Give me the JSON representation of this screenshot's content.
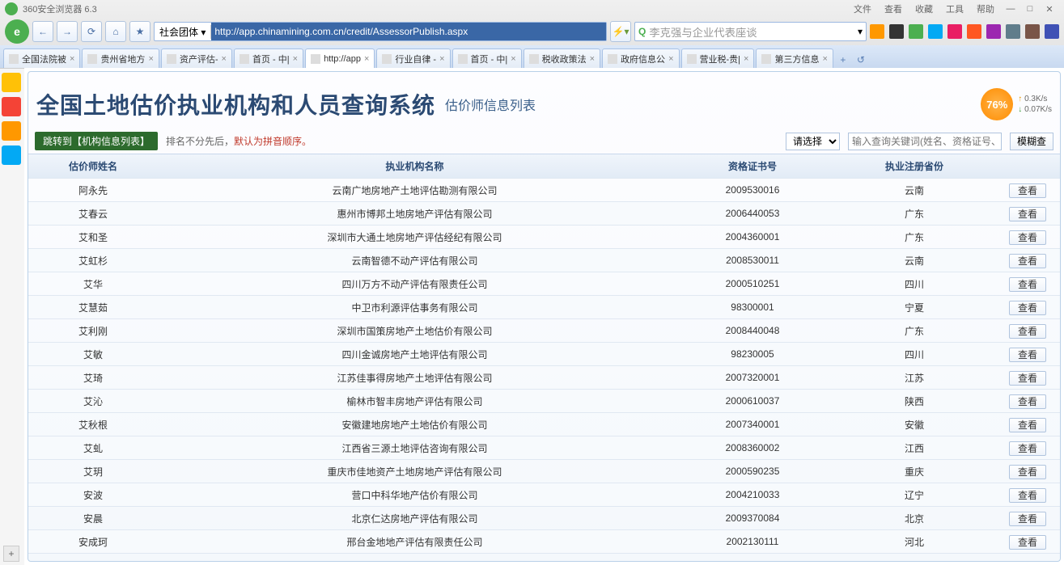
{
  "browser": {
    "title": "360安全浏览器 6.3",
    "menus": [
      "文件",
      "查看",
      "收藏",
      "工具",
      "帮助"
    ],
    "url_category": "社会团体",
    "url": "http://app.chinamining.com.cn/credit/AssessorPublish.aspx",
    "search_placeholder": "李克强与企业代表座谈",
    "net": {
      "pct": "76%",
      "up": "0.3K/s",
      "down": "0.07K/s"
    }
  },
  "tabs": [
    {
      "label": "全国法院被",
      "active": false
    },
    {
      "label": "贵州省地方",
      "active": false
    },
    {
      "label": "资产评估-",
      "active": false
    },
    {
      "label": "首页 - 中|",
      "active": false
    },
    {
      "label": "http://app",
      "active": true
    },
    {
      "label": "行业自律 -",
      "active": false
    },
    {
      "label": "首页 - 中|",
      "active": false
    },
    {
      "label": "税收政策法",
      "active": false
    },
    {
      "label": "政府信息公",
      "active": false
    },
    {
      "label": "营业税-贵|",
      "active": false
    },
    {
      "label": "第三方信息",
      "active": false
    }
  ],
  "page": {
    "title": "全国土地估价执业机构和人员查询系统",
    "subtitle": "估价师信息列表",
    "jump_btn": "跳转到【机构信息列表】",
    "hint_prefix": "排名不分先后，",
    "hint_em": "默认为拼音顺序。",
    "select_default": "请选择",
    "search_placeholder": "输入查询关键词(姓名、资格证号、",
    "search_btn": "模糊查",
    "columns": {
      "name": "估价师姓名",
      "org": "执业机构名称",
      "cert": "资格证书号",
      "prov": "执业注册省份"
    },
    "view_label": "查看",
    "rows": [
      {
        "name": "阿永先",
        "org": "云南广地房地产土地评估勘测有限公司",
        "cert": "2009530016",
        "prov": "云南"
      },
      {
        "name": "艾春云",
        "org": "惠州市博邦土地房地产评估有限公司",
        "cert": "2006440053",
        "prov": "广东"
      },
      {
        "name": "艾和圣",
        "org": "深圳市大通土地房地产评估经纪有限公司",
        "cert": "2004360001",
        "prov": "广东"
      },
      {
        "name": "艾虹杉",
        "org": "云南智德不动产评估有限公司",
        "cert": "2008530011",
        "prov": "云南"
      },
      {
        "name": "艾华",
        "org": "四川万方不动产评估有限责任公司",
        "cert": "2000510251",
        "prov": "四川"
      },
      {
        "name": "艾慧茹",
        "org": "中卫市利源评估事务有限公司",
        "cert": "98300001",
        "prov": "宁夏"
      },
      {
        "name": "艾利刚",
        "org": "深圳市国策房地产土地估价有限公司",
        "cert": "2008440048",
        "prov": "广东"
      },
      {
        "name": "艾敏",
        "org": "四川金诚房地产土地评估有限公司",
        "cert": "98230005",
        "prov": "四川"
      },
      {
        "name": "艾琦",
        "org": "江苏佳事得房地产土地评估有限公司",
        "cert": "2007320001",
        "prov": "江苏"
      },
      {
        "name": "艾沁",
        "org": "榆林市智丰房地产评估有限公司",
        "cert": "2000610037",
        "prov": "陕西"
      },
      {
        "name": "艾秋根",
        "org": "安徽建地房地产土地估价有限公司",
        "cert": "2007340001",
        "prov": "安徽"
      },
      {
        "name": "艾虬",
        "org": "江西省三源土地评估咨询有限公司",
        "cert": "2008360002",
        "prov": "江西"
      },
      {
        "name": "艾玥",
        "org": "重庆市佳地资产土地房地产评估有限公司",
        "cert": "2000590235",
        "prov": "重庆"
      },
      {
        "name": "安波",
        "org": "营口中科华地产估价有限公司",
        "cert": "2004210033",
        "prov": "辽宁"
      },
      {
        "name": "安晨",
        "org": "北京仁达房地产评估有限公司",
        "cert": "2009370084",
        "prov": "北京"
      },
      {
        "name": "安成珂",
        "org": "邢台金地地产评估有限责任公司",
        "cert": "2002130111",
        "prov": "河北"
      }
    ]
  },
  "ext_colors": [
    "#ff9800",
    "#333",
    "#4caf50",
    "#03a9f4",
    "#e91e63",
    "#ff5722",
    "#9c27b0",
    "#607d8b",
    "#795548",
    "#3f51b5"
  ],
  "dock_colors": [
    "#ffc107",
    "#f44336",
    "#ff9800",
    "#03a9f4"
  ]
}
